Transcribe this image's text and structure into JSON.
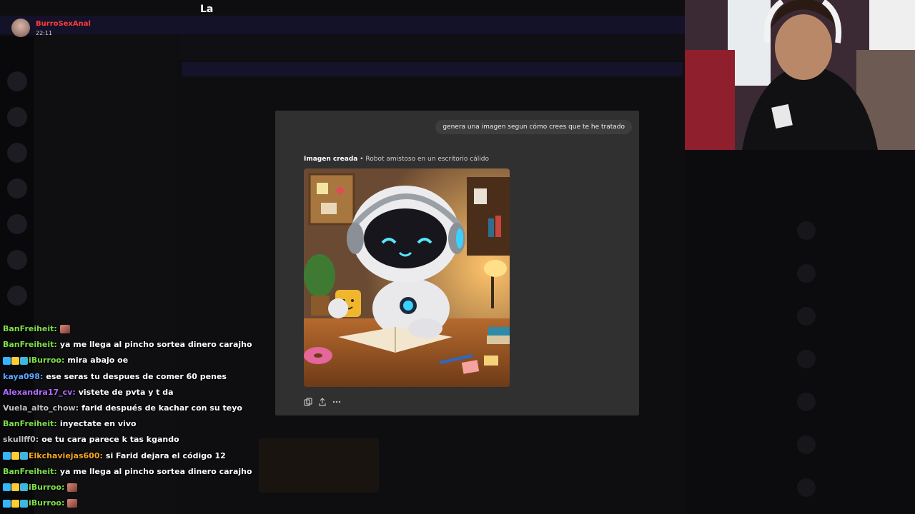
{
  "streamer": {
    "name": "BurroSexAnal",
    "time": "22:11"
  },
  "top_label": "La",
  "modal": {
    "user_prompt": "genera una imagen segun cómo crees que te he tratado",
    "image_caption_label": "Imagen creada",
    "image_caption_separator": "•",
    "image_caption_title": "Robot amistoso en un escritorio cálido",
    "actions": [
      "copy-icon",
      "share-icon",
      "more-icon"
    ]
  },
  "colors": {
    "streamer_name": "#ff3b3b",
    "modal_bg": "#303030",
    "bubble_bg": "#3d3d3d"
  },
  "chat": [
    {
      "user": "BanFreiheit",
      "color": "#7fe04a",
      "badges": [],
      "message": "",
      "emote": true
    },
    {
      "user": "BanFreiheit",
      "color": "#7fe04a",
      "badges": [],
      "message": "ya me llega al pincho sortea dinero carajho",
      "emote": false
    },
    {
      "user": "iBurroo",
      "color": "#7fe04a",
      "badges": [
        "sword",
        "crown",
        "sub"
      ],
      "message": "mira abajo oe",
      "emote": false
    },
    {
      "user": "kaya098",
      "color": "#5aa8ff",
      "badges": [],
      "message": "ese seras tu despues de comer 60 penes",
      "emote": false
    },
    {
      "user": "Alexandra17_cv",
      "color": "#b26bff",
      "badges": [],
      "message": "vistete de pvta y t da",
      "emote": false
    },
    {
      "user": "Vuela_alto_chow",
      "color": "#c2c2c2",
      "badges": [],
      "message": "farid después de kachar con su teyo",
      "emote": false
    },
    {
      "user": "BanFreiheit",
      "color": "#7fe04a",
      "badges": [],
      "message": "inyectate en vivo",
      "emote": false
    },
    {
      "user": "skullff0",
      "color": "#c2c2c2",
      "badges": [],
      "message": "oe tu cara parece k tas kgando",
      "emote": false
    },
    {
      "user": "Elkchaviejas600",
      "color": "#f5a623",
      "badges": [
        "sword",
        "crown",
        "sub"
      ],
      "message": "si Farid dejara el código 12",
      "emote": false
    },
    {
      "user": "BanFreiheit",
      "color": "#7fe04a",
      "badges": [],
      "message": "ya me llega al pincho sortea dinero carajho",
      "emote": false
    },
    {
      "user": "iBurroo",
      "color": "#7fe04a",
      "badges": [
        "sword",
        "crown",
        "sub"
      ],
      "message": "",
      "emote": true
    },
    {
      "user": "iBurroo",
      "color": "#7fe04a",
      "badges": [
        "sword",
        "crown",
        "sub"
      ],
      "message": "",
      "emote": true
    }
  ]
}
